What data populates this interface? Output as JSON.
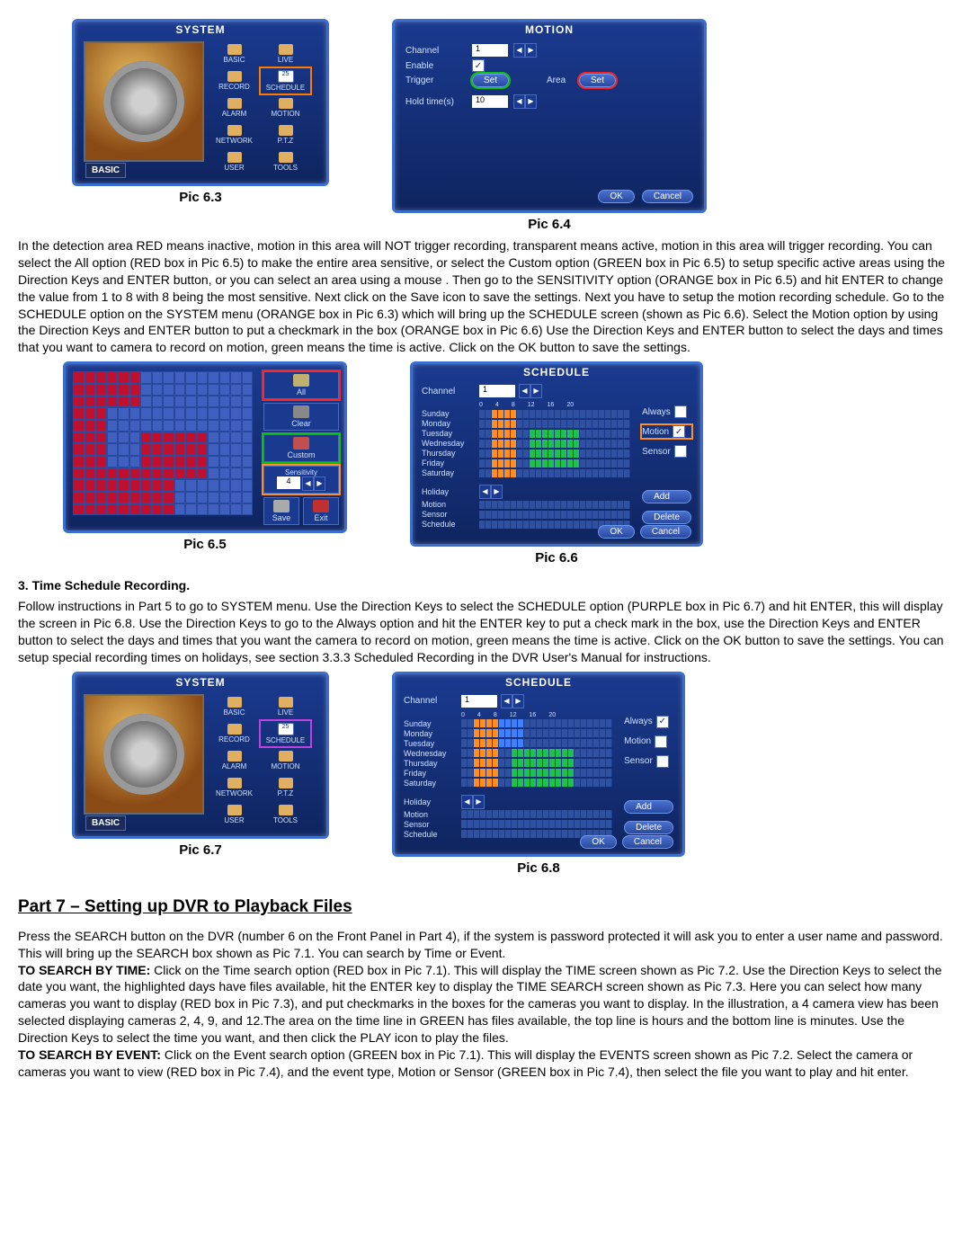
{
  "systemPanel": {
    "title": "SYSTEM",
    "bottomLabel": "BASIC",
    "menu": [
      "BASIC",
      "LIVE",
      "RECORD",
      "SCHEDULE",
      "ALARM",
      "MOTION",
      "NETWORK",
      "P.T.Z",
      "USER",
      "TOOLS"
    ],
    "schedIcon": "25"
  },
  "motionPanel": {
    "title": "MOTION",
    "channelLabel": "Channel",
    "channelValue": "1",
    "enableLabel": "Enable",
    "triggerLabel": "Trigger",
    "setBtn": "Set",
    "areaLabel": "Area",
    "holdLabel": "Hold time(s)",
    "holdValue": "10",
    "okBtn": "OK",
    "cancelBtn": "Cancel"
  },
  "detPanel": {
    "all": "All",
    "clear": "Clear",
    "custom": "Custom",
    "sensLabel": "Sensitivity",
    "sensValue": "4",
    "save": "Save",
    "exit": "Exit"
  },
  "schedulePanel": {
    "title": "SCHEDULE",
    "channelLabel": "Channel",
    "channelValue": "1",
    "ticks": [
      "0",
      "4",
      "8",
      "12",
      "16",
      "20"
    ],
    "days": [
      "Sunday",
      "Monday",
      "Tuesday",
      "Wednesday",
      "Thursday",
      "Friday",
      "Saturday"
    ],
    "holiday": "Holiday",
    "motion": "Motion",
    "sensor": "Sensor",
    "schedule": "Schedule",
    "always": "Always",
    "motionOpt": "Motion",
    "sensorOpt": "Sensor",
    "add": "Add",
    "delete": "Delete",
    "ok": "OK",
    "cancel": "Cancel"
  },
  "captions": {
    "p63": "Pic 6.3",
    "p64": "Pic 6.4",
    "p65": "Pic 6.5",
    "p66": "Pic 6.6",
    "p67": "Pic 6.7",
    "p68": "Pic 6.8"
  },
  "text": {
    "para1": "In the detection area RED means inactive, motion in this area will NOT trigger recording, transparent means active, motion in this area will trigger recording. You can select the All option (RED box in Pic 6.5) to make the entire area sensitive, or select the Custom option (GREEN box in Pic 6.5) to setup specific active areas using the Direction Keys and ENTER button, or you can select an area using a mouse . Then go to the SENSITIVITY option (ORANGE box in Pic 6.5) and hit ENTER to change the value from 1 to 8 with 8 being the most sensitive. Next click on the Save icon to save the settings. Next you have to setup the motion recording schedule. Go to the SCHEDULE option on the SYSTEM menu (ORANGE box in Pic 6.3) which will bring up the SCHEDULE screen (shown as Pic 6.6).  Select the Motion option by using the Direction Keys and ENTER button to put a checkmark in the box (ORANGE box in Pic 6.6) Use the Direction Keys and ENTER button to select the days and times that you want to camera to record on motion, green means the time is active. Click on the OK button to save the settings.",
    "section3": "3. Time Schedule Recording.",
    "para2": "Follow instructions in Part 5 to go to SYSTEM menu. Use the Direction Keys to select the SCHEDULE option (PURPLE box in Pic 6.7) and hit ENTER, this will display the screen in Pic 6.8.  Use the Direction Keys to go to the Always option and hit the ENTER key to put a check mark in the box, use the Direction Keys and ENTER button to select the days and times that you want the camera to record on motion, green means the time is active. Click on the OK button to save the settings. You can setup special recording times on holidays, see section 3.3.3 Scheduled Recording in the DVR User's Manual for instructions.",
    "part7": "Part 7 – Setting up DVR to Playback Files",
    "para3a": "Press the SEARCH button on the DVR (number 6 on the Front Panel in Part 4), if the system is password protected it will ask you to enter a user name and password. This will bring up the SEARCH box shown as Pic 7.1. You can search by Time or Event.",
    "searchTimeBold": " TO SEARCH BY TIME:",
    "para3b": " Click on the Time search option (RED box in Pic 7.1). This will display the TIME screen shown as Pic 7.2. Use the Direction Keys to select the date you want, the highlighted days have files available, hit the ENTER key to display the TIME SEARCH screen shown as Pic 7.3. Here you can select how many cameras you want to display (RED box in Pic 7.3), and put checkmarks in the boxes for the cameras you want to display. In the illustration, a 4 camera view has been selected displaying cameras 2, 4, 9, and 12.The area on the time line in GREEN has files available, the top line is hours and the bottom line is minutes.  Use the Direction Keys to select the time you want, and then click the PLAY icon to play the files.",
    "searchEventBold": "TO SEARCH BY EVENT:",
    "para3c": " Click on the Event search option (GREEN box in Pic 7.1). This will display the EVENTS screen shown as Pic 7.2. Select the camera or cameras you want to view (RED box in Pic 7.4), and the event type, Motion or Sensor (GREEN box in Pic 7.4), then select the file you want to play and hit enter."
  }
}
